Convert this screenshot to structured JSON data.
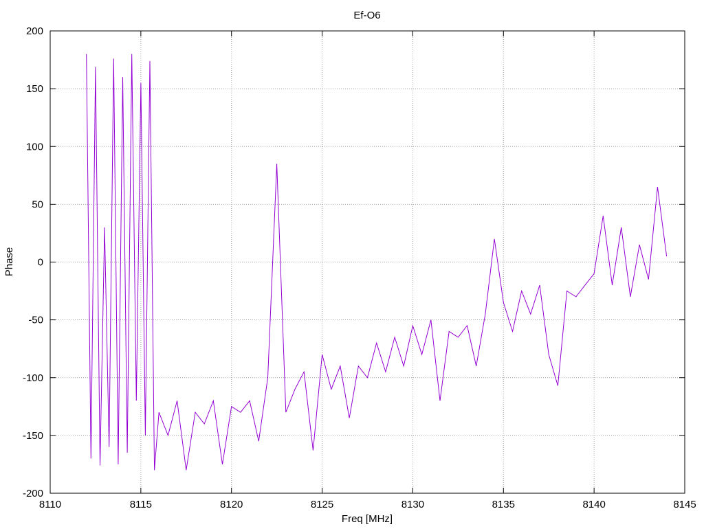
{
  "chart_data": {
    "type": "line",
    "title": "Ef-O6",
    "xlabel": "Freq [MHz]",
    "ylabel": "Phase",
    "xlim": [
      8110,
      8145
    ],
    "ylim": [
      -200,
      200
    ],
    "xticks": [
      8110,
      8115,
      8120,
      8125,
      8130,
      8135,
      8140,
      8145
    ],
    "yticks": [
      -200,
      -150,
      -100,
      -50,
      0,
      50,
      100,
      150,
      200
    ],
    "grid": true,
    "series_color": "#9400d3",
    "series": [
      {
        "x": [
          8112.0,
          8112.25,
          8112.5,
          8112.75,
          8113.0,
          8113.25,
          8113.5,
          8113.75,
          8114.0,
          8114.25,
          8114.5,
          8114.75,
          8115.0,
          8115.25,
          8115.5,
          8115.75,
          8116.0,
          8116.5,
          8117.0,
          8117.5,
          8118.0,
          8118.5,
          8119.0,
          8119.5,
          8120.0,
          8120.5,
          8121.0,
          8121.5,
          8122.0,
          8122.5,
          8123.0,
          8123.5,
          8124.0,
          8124.5,
          8125.0,
          8125.5,
          8126.0,
          8126.5,
          8127.0,
          8127.5,
          8128.0,
          8128.5,
          8129.0,
          8129.5,
          8130.0,
          8130.5,
          8131.0,
          8131.5,
          8132.0,
          8132.5,
          8133.0,
          8133.5,
          8134.0,
          8134.5,
          8135.0,
          8135.5,
          8136.0,
          8136.5,
          8137.0,
          8137.5,
          8138.0,
          8138.5,
          8139.0,
          8139.5,
          8140.0,
          8140.5,
          8141.0,
          8141.5,
          8142.0,
          8142.5,
          8143.0,
          8143.5,
          8144.0
        ],
        "y": [
          180,
          -170,
          169,
          -176,
          30,
          -160,
          176,
          -175,
          160,
          -165,
          180,
          -120,
          155,
          -150,
          174,
          -180,
          -130,
          -150,
          -120,
          -180,
          -130,
          -140,
          -120,
          -175,
          -125,
          -130,
          -120,
          -155,
          -100,
          85,
          -130,
          -110,
          -95,
          -163,
          -80,
          -110,
          -90,
          -135,
          -90,
          -100,
          -70,
          -95,
          -65,
          -90,
          -55,
          -80,
          -50,
          -120,
          -60,
          -65,
          -55,
          -90,
          -45,
          20,
          -35,
          -60,
          -25,
          -45,
          -20,
          -80,
          -107,
          -25,
          -30,
          -20,
          -10,
          40,
          -20,
          30,
          -30,
          15,
          -15,
          65,
          5
        ]
      }
    ]
  }
}
